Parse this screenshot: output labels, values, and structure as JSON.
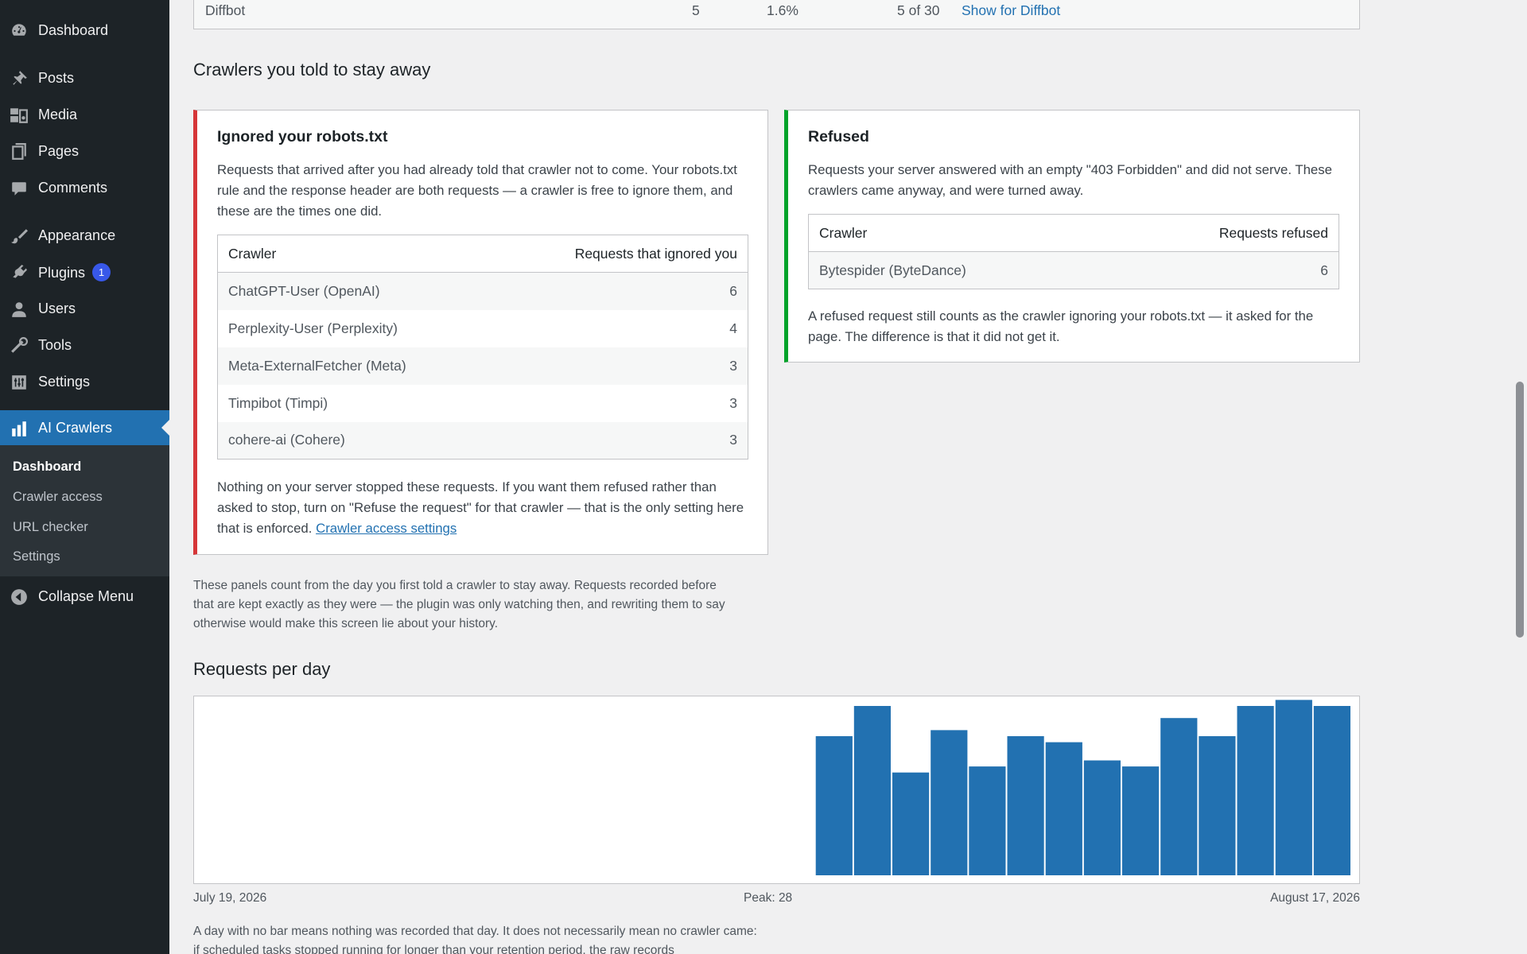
{
  "menu": {
    "items": [
      {
        "label": "Dashboard",
        "icon": "dashboard-icon"
      },
      {
        "label": "Posts",
        "icon": "pin-icon"
      },
      {
        "label": "Media",
        "icon": "media-icon"
      },
      {
        "label": "Pages",
        "icon": "pages-icon"
      },
      {
        "label": "Comments",
        "icon": "comment-icon"
      },
      {
        "label": "Appearance",
        "icon": "brush-icon"
      },
      {
        "label": "Plugins",
        "icon": "plug-icon",
        "badge": "1"
      },
      {
        "label": "Users",
        "icon": "user-icon"
      },
      {
        "label": "Tools",
        "icon": "wrench-icon"
      },
      {
        "label": "Settings",
        "icon": "sliders-icon"
      },
      {
        "label": "AI Crawlers",
        "icon": "bar-chart-icon",
        "current": true
      }
    ],
    "submenu": [
      "Dashboard",
      "Crawler access",
      "URL checker",
      "Settings"
    ],
    "collapse": "Collapse Menu"
  },
  "top_row": {
    "name": "Diffbot",
    "count": "5",
    "share": "1.6%",
    "days": "5 of 30",
    "link": "Show for Diffbot"
  },
  "section_stay_away": "Crawlers you told to stay away",
  "ignored": {
    "title": "Ignored your robots.txt",
    "intro": "Requests that arrived after you had already told that crawler not to come. Your robots.txt rule and the response header are both requests — a crawler is free to ignore them, and these are the times one did.",
    "col_crawler": "Crawler",
    "col_count": "Requests that ignored you",
    "rows": [
      {
        "name": "ChatGPT-User (OpenAI)",
        "count": "6"
      },
      {
        "name": "Perplexity-User (Perplexity)",
        "count": "4"
      },
      {
        "name": "Meta-ExternalFetcher (Meta)",
        "count": "3"
      },
      {
        "name": "Timpibot (Timpi)",
        "count": "3"
      },
      {
        "name": "cohere-ai (Cohere)",
        "count": "3"
      }
    ],
    "footer_text": "Nothing on your server stopped these requests. If you want them refused rather than asked to stop, turn on \"Refuse the request\" for that crawler — that is the only setting here that is enforced. ",
    "footer_link": "Crawler access settings"
  },
  "refused": {
    "title": "Refused",
    "intro": "Requests your server answered with an empty \"403 Forbidden\" and did not serve. These crawlers came anyway, and were turned away.",
    "col_crawler": "Crawler",
    "col_count": "Requests refused",
    "rows": [
      {
        "name": "Bytespider (ByteDance)",
        "count": "6"
      }
    ],
    "footer_text": "A refused request still counts as the crawler ignoring your robots.txt — it asked for the page. The difference is that it did not get it."
  },
  "history_note": "These panels count from the day you first told a crawler to stay away. Requests recorded before that are kept exactly as they were — the plugin was only watching then, and rewriting them to say otherwise would make this screen lie about your history.",
  "section_per_day": "Requests per day",
  "chart_labels": {
    "start": "July 19, 2026",
    "peak": "Peak: 28",
    "end": "August 17, 2026"
  },
  "chart_data": {
    "type": "bar",
    "x_start": "July 19, 2026",
    "x_end": "August 17, 2026",
    "days": 30,
    "values": [
      0,
      0,
      0,
      0,
      0,
      0,
      0,
      0,
      0,
      0,
      0,
      0,
      0,
      0,
      0,
      0,
      23,
      28,
      17,
      24,
      18,
      23,
      22,
      19,
      18,
      26,
      23,
      28,
      29,
      28
    ],
    "peak": 28,
    "ylim": [
      0,
      28
    ],
    "bar_color": "#2271b1"
  },
  "bottom_note": "A day with no bar means nothing was recorded that day. It does not necessarily mean no crawler came: if scheduled tasks stopped running for longer than your retention period, the raw records"
}
